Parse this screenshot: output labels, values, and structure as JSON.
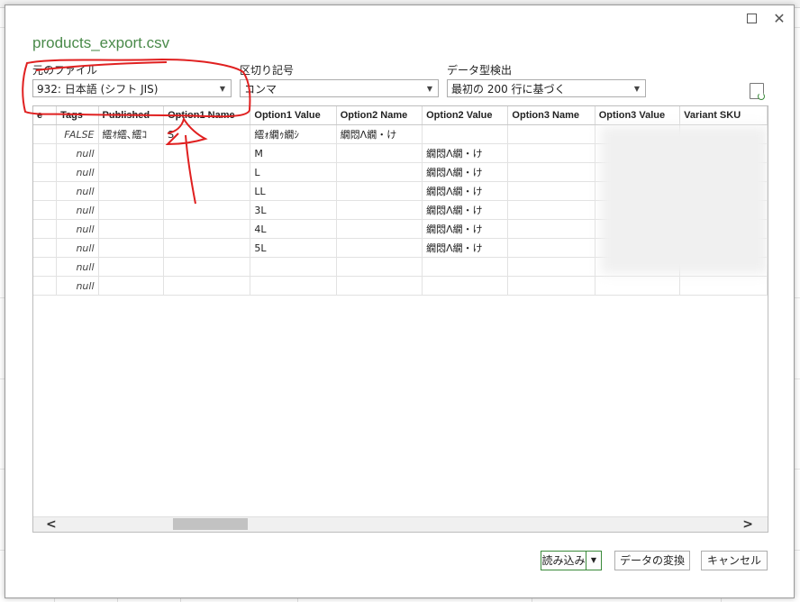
{
  "dialog": {
    "title": "products_export.csv"
  },
  "fields": {
    "source_label": "元のファイル",
    "source_value": "932: 日本語 (シフト JIS)",
    "delimiter_label": "区切り記号",
    "delimiter_value": "コンマ",
    "detect_label": "データ型検出",
    "detect_value": "最初の 200 行に基づく"
  },
  "grid": {
    "columns": [
      "e",
      "Tags",
      "Published",
      "Option1 Name",
      "Option1 Value",
      "Option2 Name",
      "Option2 Value",
      "Option3 Name",
      "Option3 Value",
      "Variant SKU"
    ],
    "rows": [
      [
        "",
        "FALSE",
        "繧ｵ繧､繧ｺ",
        "S",
        "繧ｫ繝ｩ繝ｼ",
        "繝悶Λ繝・け",
        "",
        "",
        "",
        ""
      ],
      [
        "",
        "null",
        "",
        "",
        "M",
        "",
        "繝悶Λ繝・け",
        "",
        "",
        ""
      ],
      [
        "",
        "null",
        "",
        "",
        "L",
        "",
        "繝悶Λ繝・け",
        "",
        "",
        ""
      ],
      [
        "",
        "null",
        "",
        "",
        "LL",
        "",
        "繝悶Λ繝・け",
        "",
        "",
        ""
      ],
      [
        "",
        "null",
        "",
        "",
        "3L",
        "",
        "繝悶Λ繝・け",
        "",
        "",
        ""
      ],
      [
        "",
        "null",
        "",
        "",
        "4L",
        "",
        "繝悶Λ繝・け",
        "",
        "",
        ""
      ],
      [
        "",
        "null",
        "",
        "",
        "5L",
        "",
        "繝悶Λ繝・け",
        "",
        "",
        ""
      ],
      [
        "",
        "null",
        "",
        "",
        "",
        "",
        "",
        "",
        "",
        ""
      ],
      [
        "",
        "null",
        "",
        "",
        "",
        "",
        "",
        "",
        "",
        ""
      ]
    ]
  },
  "buttons": {
    "load": "読み込み",
    "transform": "データの変換",
    "cancel": "キャンセル"
  },
  "colors": {
    "title": "#4a8a4a",
    "annotation": "#e02020",
    "accent": "#3a8a3a"
  }
}
